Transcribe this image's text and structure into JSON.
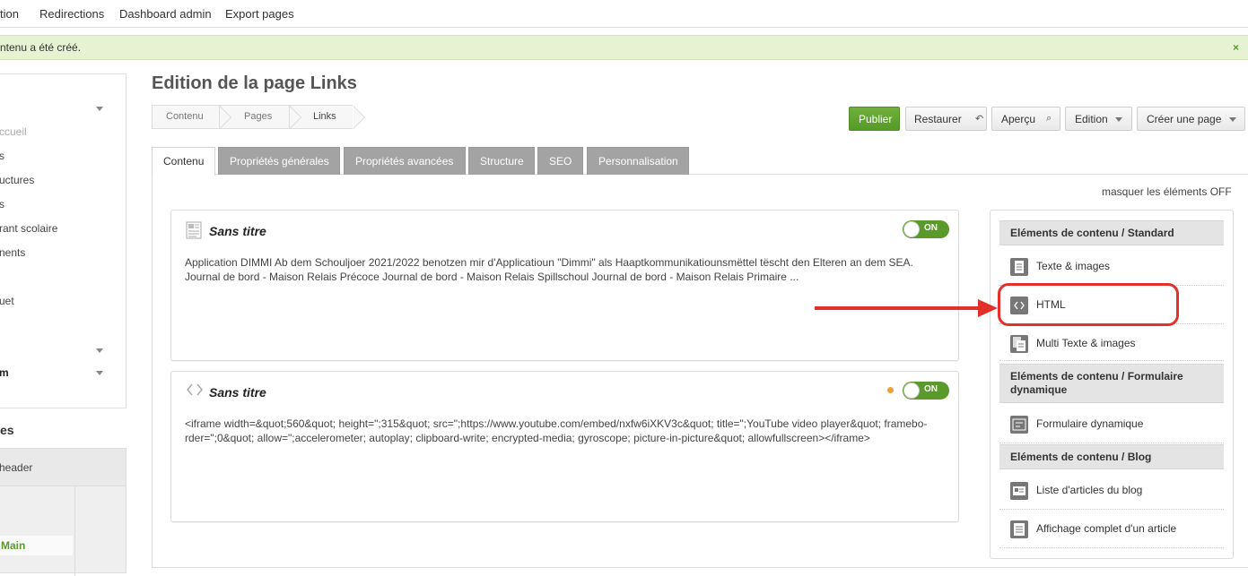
{
  "topnav": {
    "items": [
      "tion",
      "Redirections",
      "Dashboard admin",
      "Export pages"
    ]
  },
  "flash": {
    "message": "ntenu a été créé.",
    "close": "×"
  },
  "left_panel": {
    "items": [
      "ccueil",
      "s",
      "uctures",
      "s",
      "rant scolaire",
      "nents",
      "uet",
      "",
      "m"
    ],
    "section_title": "es",
    "box_header": "header",
    "main_label": "Main"
  },
  "page": {
    "title": "Edition de la page Links",
    "breadcrumb": [
      "Contenu",
      "Pages",
      "Links"
    ]
  },
  "actions": {
    "publish": "Publier",
    "restore": "Restaurer",
    "restore_icon": "↶",
    "preview": "Aperçu",
    "preview_icon": "⌕",
    "edition": "Edition",
    "create_page": "Créer une page"
  },
  "tabs": [
    "Contenu",
    "Propriétés générales",
    "Propriétés avancées",
    "Structure",
    "SEO",
    "Personnalisation"
  ],
  "toggle_hint": "masquer les éléments OFF",
  "cards": [
    {
      "title": "Sans titre",
      "icon": "text-image-icon",
      "switch_label": "ON",
      "body_lines": [
        "Application DIMMI     Ab dem Schouljoer 2021/2022 benotzen mir d'Applicatioun \"Dimmi\" als Haaptkommunikatiounsmëttel tëscht den Elteren an dem SEA.",
        "Journal de bord - Maison Relais Précoce   Journal de bord - Maison Relais Spillschoul   Journal de bord - Maison Relais Primaire   ..."
      ]
    },
    {
      "title": "Sans titre",
      "icon": "code-icon",
      "switch_label": "ON",
      "body_lines": [
        "<iframe width=&quot;560&quot; height=\";315&quot; src=\";https://www.youtube.com/embed/nxfw6iXKV3c&quot; title=\";YouTube video player&quot; framebo-",
        "rder=\";0&quot; allow=\";accelerometer; autoplay; clipboard-write; encrypted-media; gyroscope; picture-in-picture&quot; allowfullscreen></iframe>"
      ]
    }
  ],
  "palette": {
    "sections": [
      {
        "title": "Eléments de contenu / Standard",
        "items": [
          "Texte & images",
          "HTML",
          "Multi Texte & images"
        ]
      },
      {
        "title": "Eléments de contenu / Formulaire dynamique",
        "items": [
          "Formulaire dynamique"
        ]
      },
      {
        "title": "Eléments de contenu / Blog",
        "items": [
          "Liste d'articles du blog",
          "Affichage complet d'un article"
        ]
      }
    ]
  },
  "colors": {
    "accent_green": "#5a9a2a",
    "annotation_red": "#e3302b",
    "tab_gray": "#a3a3a3"
  }
}
